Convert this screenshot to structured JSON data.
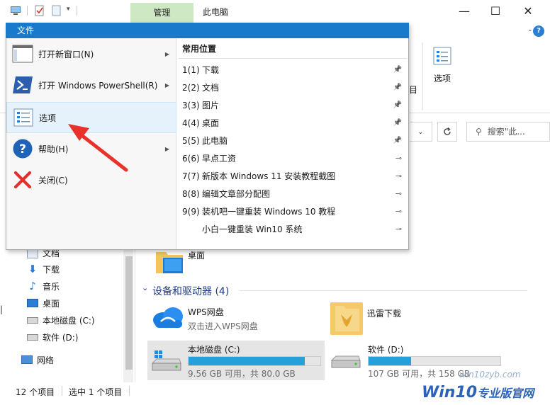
{
  "titlebar": {
    "manage_tab": "管理",
    "title": "此电脑",
    "minimize": "—",
    "maximize": "☐",
    "close": "✕",
    "help": "?"
  },
  "ribbon": {
    "options_label": "选项",
    "partial_label": "目",
    "search_placeholder": "搜索\"此..."
  },
  "file_menu": {
    "tab_label": "文件",
    "left_items": [
      {
        "label": "打开新窗口(N)",
        "has_arrow": true
      },
      {
        "label": "打开 Windows PowerShell(R)",
        "has_arrow": true
      },
      {
        "label": "选项",
        "has_arrow": false
      },
      {
        "label": "帮助(H)",
        "has_arrow": true
      },
      {
        "label": "关闭(C)",
        "has_arrow": false
      }
    ],
    "recent_header": "常用位置",
    "recent_items": [
      {
        "num": "1(1)",
        "label": "下载",
        "pinned": true
      },
      {
        "num": "2(2)",
        "label": "文档",
        "pinned": true
      },
      {
        "num": "3(3)",
        "label": "图片",
        "pinned": true
      },
      {
        "num": "4(4)",
        "label": "桌面",
        "pinned": true
      },
      {
        "num": "5(5)",
        "label": "此电脑",
        "pinned": true
      },
      {
        "num": "6(6)",
        "label": "早点工资",
        "pinned": false
      },
      {
        "num": "7(7)",
        "label": "新版本 Windows 11 安装教程截图",
        "pinned": false
      },
      {
        "num": "8(8)",
        "label": "编辑文章部分配图",
        "pinned": false
      },
      {
        "num": "9(9)",
        "label": "装机吧一键重装 Windows 10 教程",
        "pinned": false
      },
      {
        "num": "",
        "label": "小白一键重装 Win10 系统",
        "pinned": false
      }
    ]
  },
  "nav": {
    "items": [
      {
        "label": "文档",
        "icon": "document-icon"
      },
      {
        "label": "下载",
        "icon": "download-icon"
      },
      {
        "label": "音乐",
        "icon": "music-icon"
      },
      {
        "label": "桌面",
        "icon": "desktop-icon"
      },
      {
        "label": "本地磁盘 (C:)",
        "icon": "drive-icon"
      },
      {
        "label": "软件 (D:)",
        "icon": "drive-icon"
      }
    ],
    "network": "网络"
  },
  "content": {
    "desktop_folder": "桌面",
    "devices_group": "设备和驱动器 (4)",
    "drives": [
      {
        "name": "WPS网盘",
        "sub": "双击进入WPS网盘",
        "kind": "cloud"
      },
      {
        "name": "迅雷下载",
        "sub": "",
        "kind": "thunder"
      },
      {
        "name": "本地磁盘 (C:)",
        "sub": "9.56 GB 可用，共 80.0 GB",
        "used_fraction": 0.88,
        "kind": "system-drive"
      },
      {
        "name": "软件 (D:)",
        "sub": "107 GB 可用，共 158 GB",
        "used_fraction": 0.32,
        "kind": "drive"
      }
    ]
  },
  "status": {
    "count": "12 个项目",
    "selected": "选中 1 个项目"
  },
  "watermark": {
    "url": "win10zyb.com",
    "brand": "Win10",
    "brand_sub": "专业版官网"
  },
  "colors": {
    "accent": "#1979ca",
    "manage_tab": "#cfe8c4",
    "progress": "#26a0da",
    "red_arrow": "#e8312b"
  }
}
